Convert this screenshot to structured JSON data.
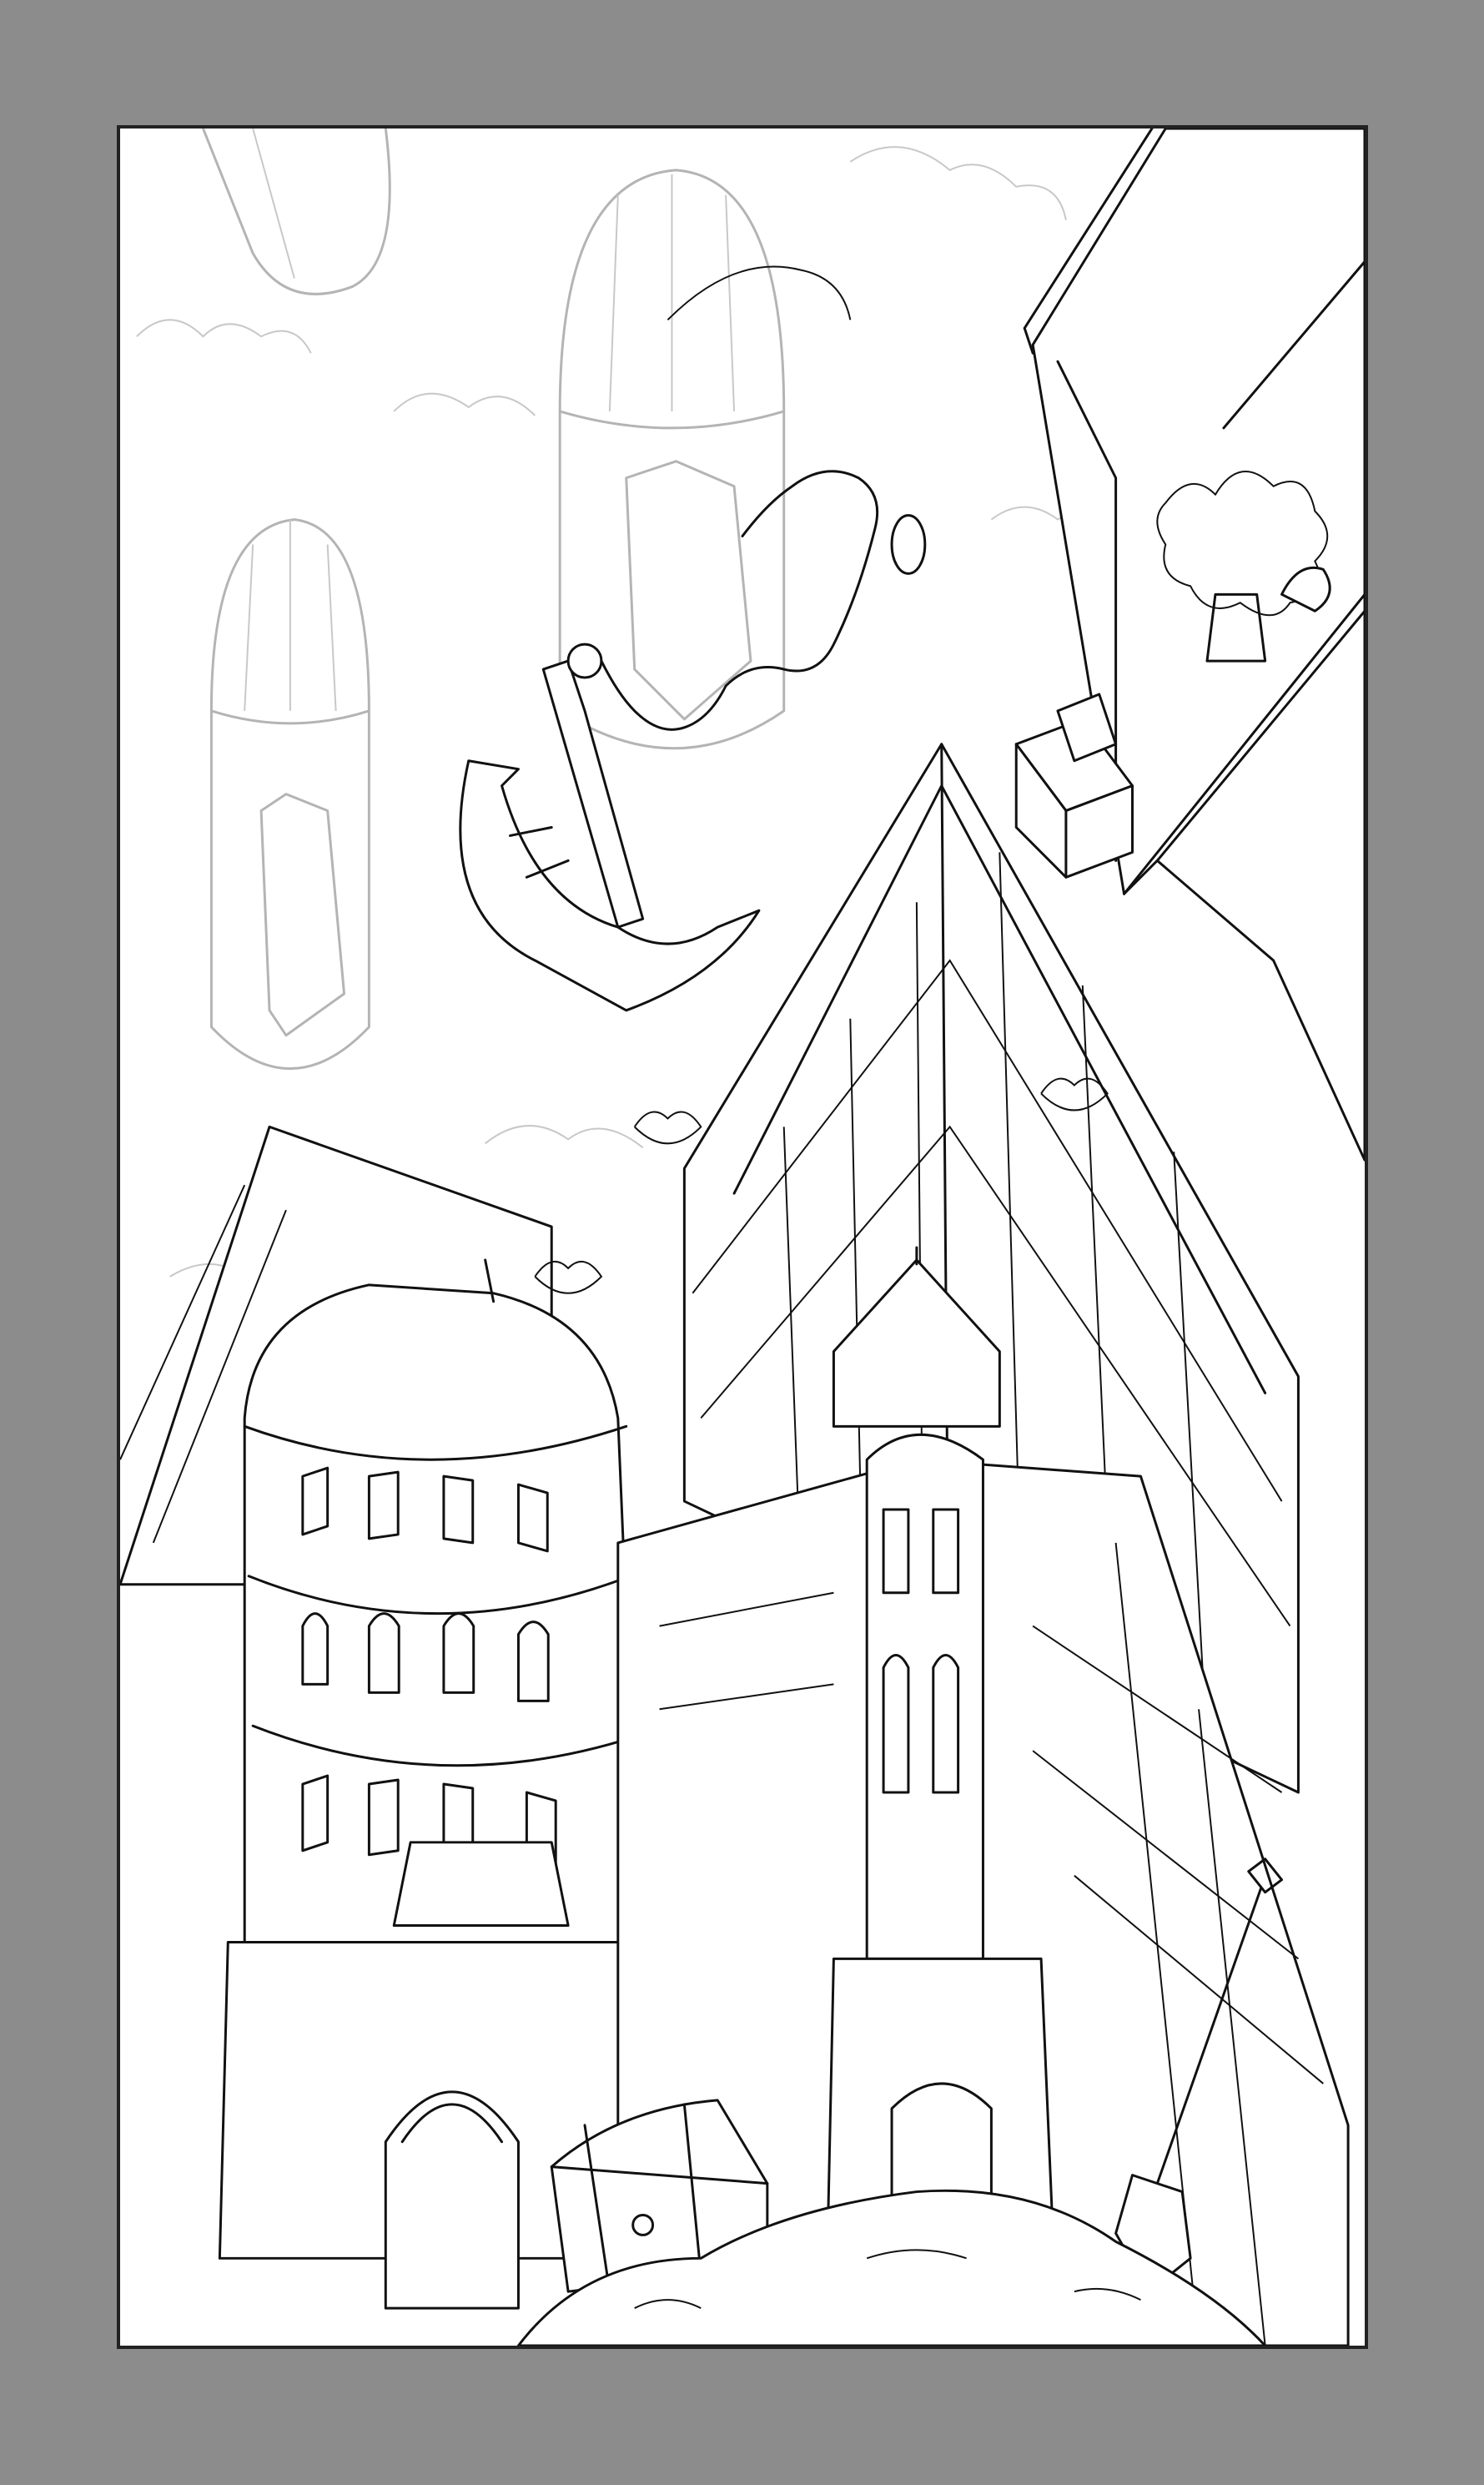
{
  "image": {
    "background_color": "#8c8c8c",
    "panel_color": "#ffffff",
    "line_color": "#111111",
    "faint_line_color": "#b4b4b4"
  }
}
